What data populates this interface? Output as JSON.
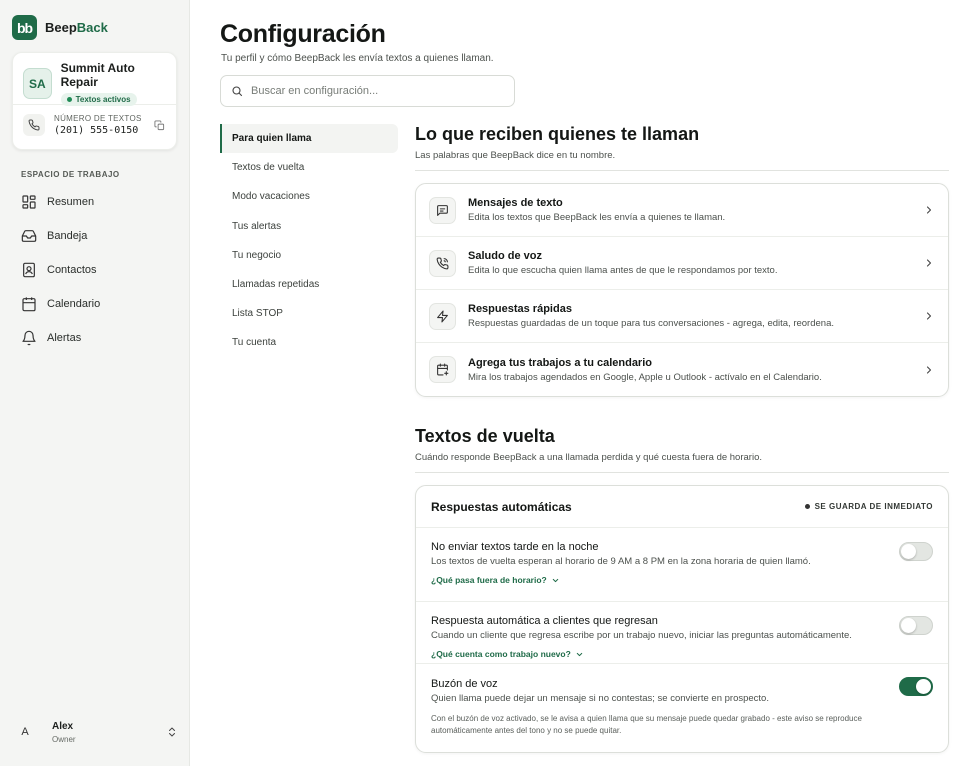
{
  "brand": {
    "logo_text": "bb",
    "name_part1": "Beep",
    "name_part2": "Back",
    "accent_color": "#1f6b48"
  },
  "account": {
    "initials": "SA",
    "name": "Summit Auto Repair",
    "status": "Textos activos",
    "phone_label": "NÚMERO DE TEXTOS",
    "phone_number": "(201) 555-0150"
  },
  "sidebar": {
    "section_label": "ESPACIO DE TRABAJO",
    "items": [
      {
        "label": "Resumen",
        "icon": "dashboard-icon"
      },
      {
        "label": "Bandeja",
        "icon": "inbox-icon"
      },
      {
        "label": "Contactos",
        "icon": "contacts-icon"
      },
      {
        "label": "Calendario",
        "icon": "calendar-icon"
      },
      {
        "label": "Alertas",
        "icon": "bell-icon"
      }
    ]
  },
  "user": {
    "initial": "A",
    "name": "Alex",
    "role": "Owner"
  },
  "header": {
    "title": "Configuración",
    "subtitle": "Tu perfil y cómo BeepBack les envía textos a quienes llaman.",
    "search_placeholder": "Buscar en configuración..."
  },
  "subnav": {
    "items": [
      "Para quien llama",
      "Textos de vuelta",
      "Modo vacaciones",
      "Tus alertas",
      "Tu negocio",
      "Llamadas repetidas",
      "Lista STOP",
      "Tu cuenta"
    ],
    "active_index": 0
  },
  "section1": {
    "title": "Lo que reciben quienes te llaman",
    "subtitle": "Las palabras que BeepBack dice en tu nombre.",
    "rows": [
      {
        "title": "Mensajes de texto",
        "desc": "Edita los textos que BeepBack les envía a quienes te llaman.",
        "icon": "message-icon"
      },
      {
        "title": "Saludo de voz",
        "desc": "Edita lo que escucha quien llama antes de que le respondamos por texto.",
        "icon": "phone-voice-icon"
      },
      {
        "title": "Respuestas rápidas",
        "desc": "Respuestas guardadas de un toque para tus conversaciones - agrega, edita, reordena.",
        "icon": "lightning-icon"
      },
      {
        "title": "Agrega tus trabajos a tu calendario",
        "desc": "Mira los trabajos agendados en Google, Apple u Outlook - actívalo en el Calendario.",
        "icon": "calendar-add-icon"
      }
    ]
  },
  "section2": {
    "title": "Textos de vuelta",
    "subtitle": "Cuándo responde BeepBack a una llamada perdida y qué cuesta fuera de horario.",
    "card_title": "Respuestas automáticas",
    "save_note": "SE GUARDA DE INMEDIATO",
    "settings": [
      {
        "title": "No enviar textos tarde en la noche",
        "desc": "Los textos de vuelta esperan al horario de 9 AM a 8 PM en la zona horaria de quien llamó.",
        "more": "¿Qué pasa fuera de horario?",
        "enabled": false
      },
      {
        "title": "Respuesta automática a clientes que regresan",
        "desc": "Cuando un cliente que regresa escribe por un trabajo nuevo, iniciar las preguntas automáticamente.",
        "more": "¿Qué cuenta como trabajo nuevo?",
        "enabled": false
      },
      {
        "title": "Buzón de voz",
        "desc": "Quien llama puede dejar un mensaje si no contestas; se convierte en prospecto.",
        "note": "Con el buzón de voz activado, se le avisa a quien llama que su mensaje puede quedar grabado - este aviso se reproduce automáticamente antes del tono y no se puede quitar.",
        "enabled": true
      }
    ]
  }
}
